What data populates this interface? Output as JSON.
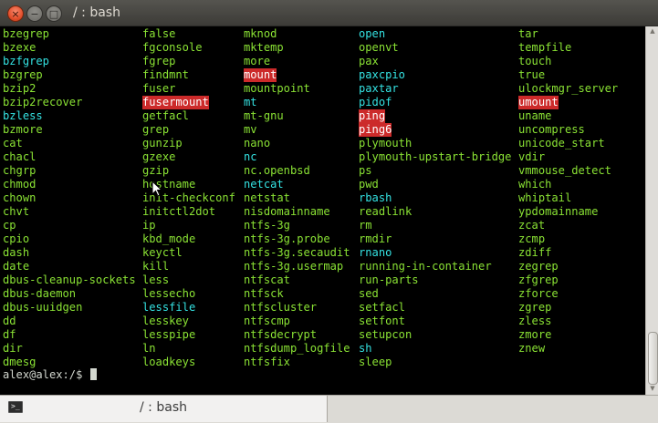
{
  "window": {
    "title": "/ : bash",
    "close_glyph": "×",
    "minimize_glyph": "−",
    "maximize_glyph": "□"
  },
  "tab": {
    "label": "/ : bash",
    "icon": "terminal-icon"
  },
  "colors": {
    "executable": "#8ae234",
    "symlink": "#34e2e2",
    "setuid_bg": "#cc2a2a",
    "background": "#000000",
    "prompt": "#d3d7cf"
  },
  "terminal": {
    "columns": [
      [
        {
          "name": "bzegrep",
          "t": "exec"
        },
        {
          "name": "bzexe",
          "t": "exec"
        },
        {
          "name": "bzfgrep",
          "t": "link"
        },
        {
          "name": "bzgrep",
          "t": "exec"
        },
        {
          "name": "bzip2",
          "t": "exec"
        },
        {
          "name": "bzip2recover",
          "t": "exec"
        },
        {
          "name": "bzless",
          "t": "link"
        },
        {
          "name": "bzmore",
          "t": "exec"
        },
        {
          "name": "cat",
          "t": "exec"
        },
        {
          "name": "chacl",
          "t": "exec"
        },
        {
          "name": "chgrp",
          "t": "exec"
        },
        {
          "name": "chmod",
          "t": "exec"
        },
        {
          "name": "chown",
          "t": "exec"
        },
        {
          "name": "chvt",
          "t": "exec"
        },
        {
          "name": "cp",
          "t": "exec"
        },
        {
          "name": "cpio",
          "t": "exec"
        },
        {
          "name": "dash",
          "t": "exec"
        },
        {
          "name": "date",
          "t": "exec"
        },
        {
          "name": "dbus-cleanup-sockets",
          "t": "exec"
        },
        {
          "name": "dbus-daemon",
          "t": "exec"
        },
        {
          "name": "dbus-uuidgen",
          "t": "exec"
        },
        {
          "name": "dd",
          "t": "exec"
        },
        {
          "name": "df",
          "t": "exec"
        },
        {
          "name": "dir",
          "t": "exec"
        },
        {
          "name": "dmesg",
          "t": "exec"
        }
      ],
      [
        {
          "name": "false",
          "t": "exec"
        },
        {
          "name": "fgconsole",
          "t": "exec"
        },
        {
          "name": "fgrep",
          "t": "exec"
        },
        {
          "name": "findmnt",
          "t": "exec"
        },
        {
          "name": "fuser",
          "t": "exec"
        },
        {
          "name": "fusermount",
          "t": "setuid"
        },
        {
          "name": "getfacl",
          "t": "exec"
        },
        {
          "name": "grep",
          "t": "exec"
        },
        {
          "name": "gunzip",
          "t": "exec"
        },
        {
          "name": "gzexe",
          "t": "exec"
        },
        {
          "name": "gzip",
          "t": "exec"
        },
        {
          "name": "hostname",
          "t": "exec"
        },
        {
          "name": "init-checkconf",
          "t": "exec"
        },
        {
          "name": "initctl2dot",
          "t": "exec"
        },
        {
          "name": "ip",
          "t": "exec"
        },
        {
          "name": "kbd_mode",
          "t": "exec"
        },
        {
          "name": "keyctl",
          "t": "exec"
        },
        {
          "name": "kill",
          "t": "exec"
        },
        {
          "name": "less",
          "t": "exec"
        },
        {
          "name": "lessecho",
          "t": "exec"
        },
        {
          "name": "lessfile",
          "t": "link"
        },
        {
          "name": "lesskey",
          "t": "exec"
        },
        {
          "name": "lesspipe",
          "t": "exec"
        },
        {
          "name": "ln",
          "t": "exec"
        },
        {
          "name": "loadkeys",
          "t": "exec"
        }
      ],
      [
        {
          "name": "mknod",
          "t": "exec"
        },
        {
          "name": "mktemp",
          "t": "exec"
        },
        {
          "name": "more",
          "t": "exec"
        },
        {
          "name": "mount",
          "t": "setuid"
        },
        {
          "name": "mountpoint",
          "t": "exec"
        },
        {
          "name": "mt",
          "t": "link"
        },
        {
          "name": "mt-gnu",
          "t": "exec"
        },
        {
          "name": "mv",
          "t": "exec"
        },
        {
          "name": "nano",
          "t": "exec"
        },
        {
          "name": "nc",
          "t": "link"
        },
        {
          "name": "nc.openbsd",
          "t": "exec"
        },
        {
          "name": "netcat",
          "t": "link"
        },
        {
          "name": "netstat",
          "t": "exec"
        },
        {
          "name": "nisdomainname",
          "t": "exec"
        },
        {
          "name": "ntfs-3g",
          "t": "exec"
        },
        {
          "name": "ntfs-3g.probe",
          "t": "exec"
        },
        {
          "name": "ntfs-3g.secaudit",
          "t": "exec"
        },
        {
          "name": "ntfs-3g.usermap",
          "t": "exec"
        },
        {
          "name": "ntfscat",
          "t": "exec"
        },
        {
          "name": "ntfsck",
          "t": "exec"
        },
        {
          "name": "ntfscluster",
          "t": "exec"
        },
        {
          "name": "ntfscmp",
          "t": "exec"
        },
        {
          "name": "ntfsdecrypt",
          "t": "exec"
        },
        {
          "name": "ntfsdump_logfile",
          "t": "exec"
        },
        {
          "name": "ntfsfix",
          "t": "exec"
        }
      ],
      [
        {
          "name": "open",
          "t": "link"
        },
        {
          "name": "openvt",
          "t": "exec"
        },
        {
          "name": "pax",
          "t": "exec"
        },
        {
          "name": "paxcpio",
          "t": "link"
        },
        {
          "name": "paxtar",
          "t": "link"
        },
        {
          "name": "pidof",
          "t": "link"
        },
        {
          "name": "ping",
          "t": "setuid"
        },
        {
          "name": "ping6",
          "t": "setuid"
        },
        {
          "name": "plymouth",
          "t": "exec"
        },
        {
          "name": "plymouth-upstart-bridge",
          "t": "exec"
        },
        {
          "name": "ps",
          "t": "exec"
        },
        {
          "name": "pwd",
          "t": "exec"
        },
        {
          "name": "rbash",
          "t": "link"
        },
        {
          "name": "readlink",
          "t": "exec"
        },
        {
          "name": "rm",
          "t": "exec"
        },
        {
          "name": "rmdir",
          "t": "exec"
        },
        {
          "name": "rnano",
          "t": "link"
        },
        {
          "name": "running-in-container",
          "t": "exec"
        },
        {
          "name": "run-parts",
          "t": "exec"
        },
        {
          "name": "sed",
          "t": "exec"
        },
        {
          "name": "setfacl",
          "t": "exec"
        },
        {
          "name": "setfont",
          "t": "exec"
        },
        {
          "name": "setupcon",
          "t": "exec"
        },
        {
          "name": "sh",
          "t": "link"
        },
        {
          "name": "sleep",
          "t": "exec"
        }
      ],
      [
        {
          "name": "tar",
          "t": "exec"
        },
        {
          "name": "tempfile",
          "t": "exec"
        },
        {
          "name": "touch",
          "t": "exec"
        },
        {
          "name": "true",
          "t": "exec"
        },
        {
          "name": "ulockmgr_server",
          "t": "exec"
        },
        {
          "name": "umount",
          "t": "setuid"
        },
        {
          "name": "uname",
          "t": "exec"
        },
        {
          "name": "uncompress",
          "t": "exec"
        },
        {
          "name": "unicode_start",
          "t": "exec"
        },
        {
          "name": "vdir",
          "t": "exec"
        },
        {
          "name": "vmmouse_detect",
          "t": "exec"
        },
        {
          "name": "which",
          "t": "exec"
        },
        {
          "name": "whiptail",
          "t": "exec"
        },
        {
          "name": "ypdomainname",
          "t": "exec"
        },
        {
          "name": "zcat",
          "t": "exec"
        },
        {
          "name": "zcmp",
          "t": "exec"
        },
        {
          "name": "zdiff",
          "t": "exec"
        },
        {
          "name": "zegrep",
          "t": "exec"
        },
        {
          "name": "zfgrep",
          "t": "exec"
        },
        {
          "name": "zforce",
          "t": "exec"
        },
        {
          "name": "zgrep",
          "t": "exec"
        },
        {
          "name": "zless",
          "t": "exec"
        },
        {
          "name": "zmore",
          "t": "exec"
        },
        {
          "name": "znew",
          "t": "exec"
        }
      ]
    ],
    "prompt": "alex@alex:/$ "
  }
}
